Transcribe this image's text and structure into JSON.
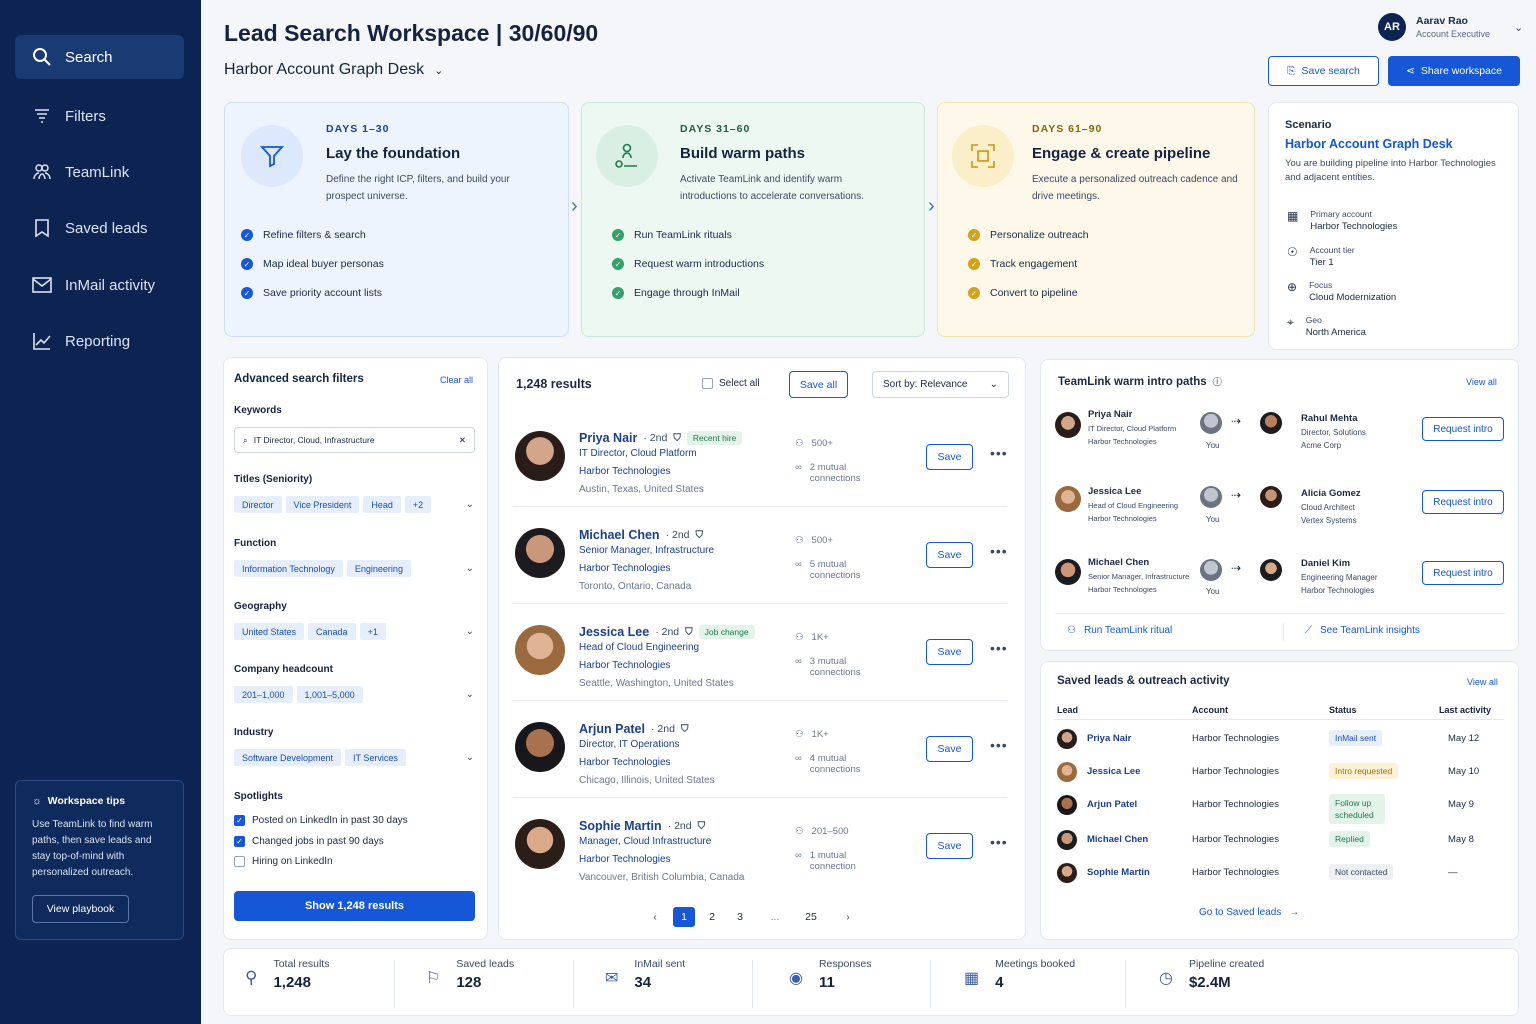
{
  "sidebar": {
    "items": [
      "Search",
      "Filters",
      "TeamLink",
      "Saved leads",
      "InMail activity",
      "Reporting"
    ],
    "tips": {
      "title": "Workspace tips",
      "text": "Use TeamLink to find warm paths, then save leads and stay top-of-mind with personalized outreach.",
      "button": "View playbook"
    }
  },
  "header": {
    "title": "Lead Search Workspace | 30/60/90",
    "subtitle": "Harbor Account Graph Desk",
    "user_initials": "AR",
    "user_name": "Aarav Rao",
    "user_role": "Account Executive",
    "save_search": "Save search",
    "share_workspace": "Share workspace"
  },
  "phases": [
    {
      "days": "DAYS 1–30",
      "title": "Lay the foundation",
      "desc": "Define the right ICP, filters, and build your prospect universe.",
      "items": [
        "Refine filters & search",
        "Map ideal buyer personas",
        "Save priority account lists"
      ]
    },
    {
      "days": "DAYS 31–60",
      "title": "Build warm paths",
      "desc": "Activate TeamLink and identify warm introductions to accelerate conversations.",
      "items": [
        "Run TeamLink rituals",
        "Request warm introductions",
        "Engage through InMail"
      ]
    },
    {
      "days": "DAYS 61–90",
      "title": "Engage & create pipeline",
      "desc": "Execute a personalized outreach cadence and drive meetings.",
      "items": [
        "Personalize outreach",
        "Track engagement",
        "Convert to pipeline"
      ]
    }
  ],
  "scenario": {
    "label": "Scenario",
    "name": "Harbor Account Graph Desk",
    "desc": "You are building pipeline into Harbor Technologies and adjacent entities.",
    "rows": [
      {
        "k": "Primary account",
        "v": "Harbor Technologies"
      },
      {
        "k": "Account tier",
        "v": "Tier 1"
      },
      {
        "k": "Focus",
        "v": "Cloud Modernization"
      },
      {
        "k": "Geo",
        "v": "North America"
      }
    ]
  },
  "filters": {
    "title": "Advanced search filters",
    "clear": "Clear all",
    "keywords_label": "Keywords",
    "keywords_value": "IT Director, Cloud, Infrastructure",
    "titles_label": "Titles (Seniority)",
    "titles": [
      "Director",
      "Vice President",
      "Head",
      "+2"
    ],
    "function_label": "Function",
    "function": [
      "Information Technology",
      "Engineering"
    ],
    "geo_label": "Geography",
    "geo": [
      "United States",
      "Canada",
      "+1"
    ],
    "headcount_label": "Company headcount",
    "headcount": [
      "201–1,000",
      "1,001–5,000"
    ],
    "industry_label": "Industry",
    "industry": [
      "Software Development",
      "IT Services"
    ],
    "spotlights_label": "Spotlights",
    "spotlights": [
      "Posted on LinkedIn in past 30 days",
      "Changed jobs in past 90 days",
      "Hiring on LinkedIn"
    ],
    "show": "Show 1,248 results"
  },
  "results": {
    "count": "1,248 results",
    "select_all": "Select all",
    "save_all": "Save all",
    "sort": "Sort by: Relevance",
    "save": "Save",
    "people": [
      {
        "name": "Priya Nair",
        "deg": "· 2nd",
        "badge": "Recent hire",
        "title": "IT Director, Cloud Platform",
        "company": "Harbor Technologies",
        "loc": "Austin, Texas, United States",
        "conn": "500+",
        "mutual": "2 mutual",
        "mutual2": "connections"
      },
      {
        "name": "Michael Chen",
        "deg": "· 2nd",
        "badge": "",
        "title": "Senior Manager, Infrastructure",
        "company": "Harbor Technologies",
        "loc": "Toronto, Ontario, Canada",
        "conn": "500+",
        "mutual": "5 mutual",
        "mutual2": "connections"
      },
      {
        "name": "Jessica Lee",
        "deg": "· 2nd",
        "badge": "Job change",
        "title": "Head of Cloud Engineering",
        "company": "Harbor Technologies",
        "loc": "Seattle, Washington, United States",
        "conn": "1K+",
        "mutual": "3 mutual",
        "mutual2": "connections"
      },
      {
        "name": "Arjun Patel",
        "deg": "· 2nd",
        "badge": "",
        "title": "Director, IT Operations",
        "company": "Harbor Technologies",
        "loc": "Chicago, Illinois, United States",
        "conn": "1K+",
        "mutual": "4 mutual",
        "mutual2": "connections"
      },
      {
        "name": "Sophie Martin",
        "deg": "· 2nd",
        "badge": "",
        "title": "Manager, Cloud Infrastructure",
        "company": "Harbor Technologies",
        "loc": "Vancouver, British Columbia, Canada",
        "conn": "201–500",
        "mutual": "1 mutual",
        "mutual2": "connection"
      }
    ],
    "pages": [
      "1",
      "2",
      "3",
      "...",
      "25"
    ]
  },
  "teamlink": {
    "title": "TeamLink warm intro paths",
    "view_all": "View all",
    "you": "You",
    "request": "Request intro",
    "paths": [
      {
        "from": "Priya Nair",
        "from_sub1": "IT Director, Cloud Platform",
        "from_sub2": "Harbor Technologies",
        "to": "Rahul Mehta",
        "to_sub1": "Director, Solutions",
        "to_sub2": "Acme Corp"
      },
      {
        "from": "Jessica Lee",
        "from_sub1": "Head of Cloud Engineering",
        "from_sub2": "Harbor Technologies",
        "to": "Alicia Gomez",
        "to_sub1": "Cloud Architect",
        "to_sub2": "Vertex Systems"
      },
      {
        "from": "Michael Chen",
        "from_sub1": "Senior Manager, Infrastructure",
        "from_sub2": "Harbor Technologies",
        "to": "Daniel Kim",
        "to_sub1": "Engineering Manager",
        "to_sub2": "Harbor Technologies"
      }
    ],
    "run": "Run TeamLink ritual",
    "insights": "See TeamLink insights"
  },
  "saved": {
    "title": "Saved leads & outreach activity",
    "view_all": "View all",
    "cols": [
      "Lead",
      "Account",
      "Status",
      "Last activity"
    ],
    "rows": [
      {
        "lead": "Priya Nair",
        "account": "Harbor Technologies",
        "status": "InMail sent",
        "last": "May 12"
      },
      {
        "lead": "Jessica Lee",
        "account": "Harbor Technologies",
        "status": "Intro requested",
        "last": "May 10"
      },
      {
        "lead": "Arjun Patel",
        "account": "Harbor Technologies",
        "status": "Follow up scheduled",
        "last": "May 9"
      },
      {
        "lead": "Michael Chen",
        "account": "Harbor Technologies",
        "status": "Replied",
        "last": "May 8"
      },
      {
        "lead": "Sophie Martin",
        "account": "Harbor Technologies",
        "status": "Not contacted",
        "last": "—"
      }
    ],
    "go": "Go to Saved leads"
  },
  "stats": [
    {
      "k": "Total results",
      "v": "1,248"
    },
    {
      "k": "Saved leads",
      "v": "128"
    },
    {
      "k": "InMail sent",
      "v": "34"
    },
    {
      "k": "Responses",
      "v": "11"
    },
    {
      "k": "Meetings booked",
      "v": "4"
    },
    {
      "k": "Pipeline created",
      "v": "$2.4M"
    }
  ]
}
